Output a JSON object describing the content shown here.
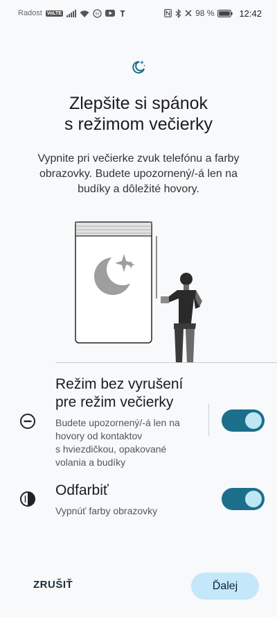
{
  "status_bar": {
    "carrier": "Radost",
    "volte_badge": "VoLTE",
    "battery_percent": "98 %",
    "time": "12:42",
    "icons": [
      "signal-icon",
      "wifi-icon",
      "data-saver-icon",
      "youtube-icon",
      "pin-icon",
      "nfc-icon",
      "bluetooth-icon",
      "close-icon",
      "battery-icon"
    ]
  },
  "header": {
    "icon": "bedtime-moon-icon",
    "title": "Zlepšite si spánok\ns režimom večierky",
    "description": "Vypnite pri večierke zvuk telefónu a farby\nobrazovky. Budete upozornený/-á len na\nbudíky a dôležité hovory."
  },
  "settings": [
    {
      "icon": "do-not-disturb-icon",
      "title": "Režim bez vyrušení\npre režim večierky",
      "subtitle": "Budete upozornený/-á len na\nhovory od kontaktov\ns hviezdičkou, opakované\nvolania a budíky",
      "enabled": true
    },
    {
      "icon": "grayscale-icon",
      "title": "Odfarbiť",
      "subtitle": "Vypnúť farby obrazovky",
      "enabled": true
    }
  ],
  "footer": {
    "cancel_label": "ZRUŠIŤ",
    "next_label": "Ďalej"
  },
  "colors": {
    "accent": "#1b6f8a",
    "toggle_knob": "#bfe6f5",
    "next_button_bg": "#c4e7fa",
    "background": "#f7f9fb"
  }
}
